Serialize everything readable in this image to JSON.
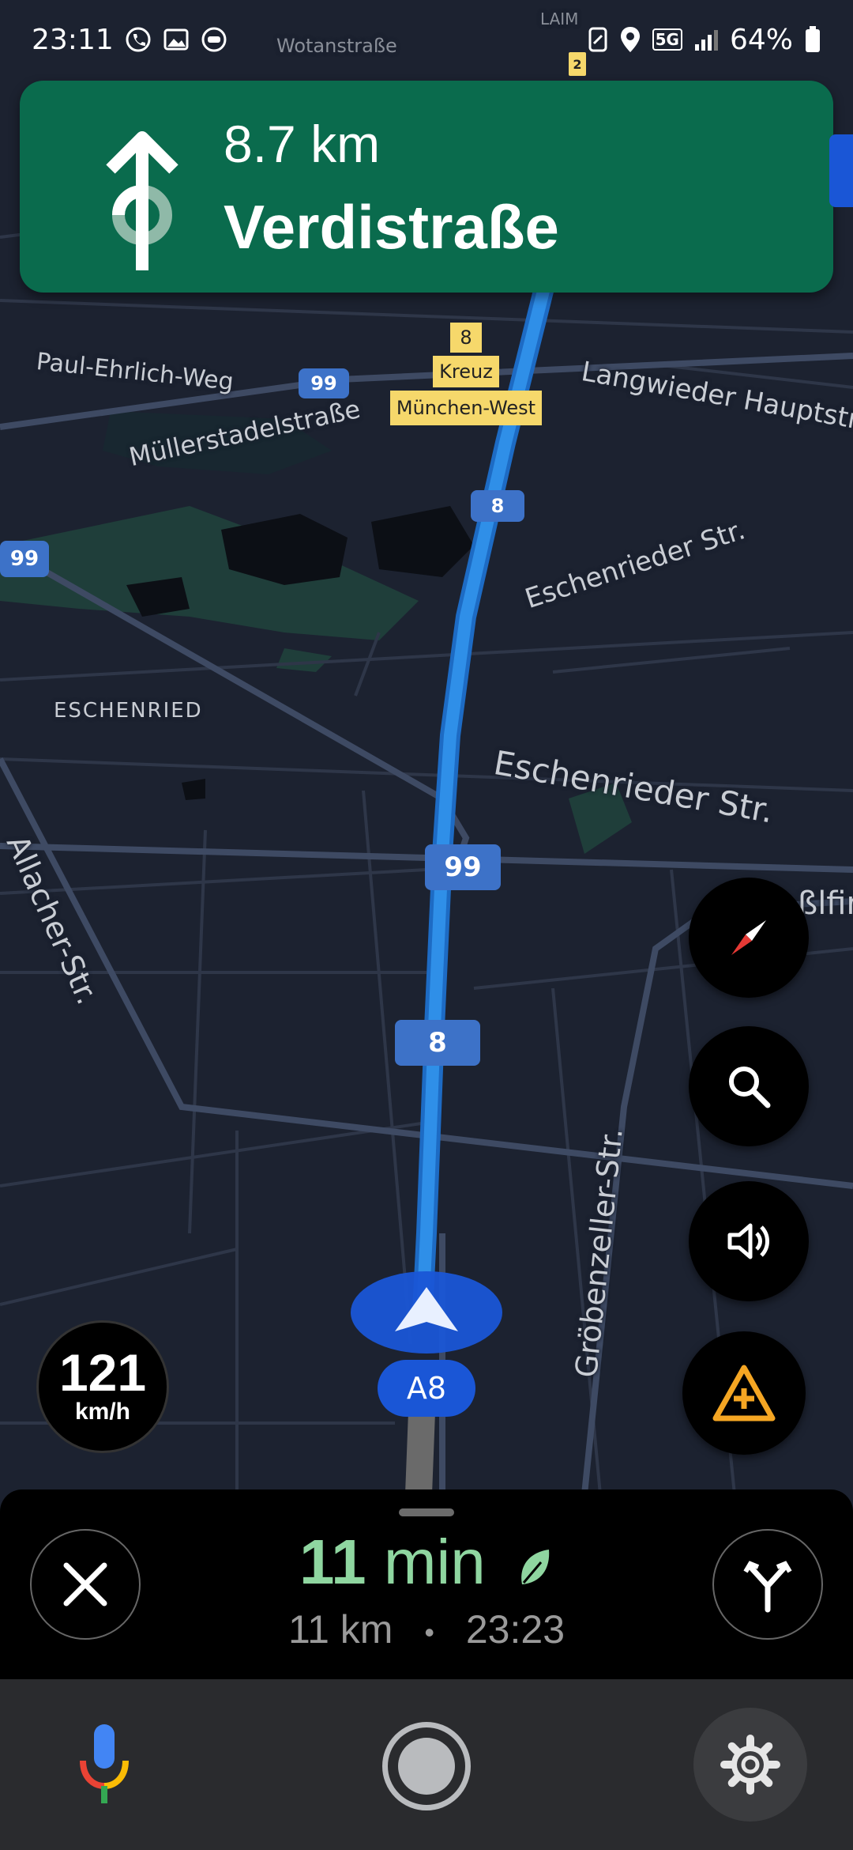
{
  "status_bar": {
    "time": "23:11",
    "battery": "64%",
    "network": "5G"
  },
  "guidance": {
    "distance": "8.7 km",
    "street": "Verdistraße",
    "maneuver_icon": "arrow-straight-roundabout-icon"
  },
  "map": {
    "labels": {
      "paul_ehrlich": "Paul-Ehrlich-Weg",
      "muellerstadel": "Müllerstadelstraße",
      "langwieder": "Langwieder Hauptstra",
      "eschenrieder1": "Eschenrieder Str.",
      "eschenrieder2": "Eschenrieder Str.",
      "eschenried": "ESCHENRIED",
      "allacher": "Allacher-Str.",
      "groebenzeller": "Gröbenzeller-Str.",
      "wotanstrasse": "Wotanstraße",
      "laim": "LAIM",
      "fragment_right": "ßlfir"
    },
    "signs": {
      "exit_number": "8",
      "line1": "Kreuz",
      "line2": "München-West"
    },
    "shields": {
      "r99a": "99",
      "r99b": "99",
      "r99c": "99",
      "r8a": "8",
      "r8b": "8",
      "r2": "2"
    },
    "current_road": "A8"
  },
  "speedometer": {
    "value": "121",
    "unit": "km/h"
  },
  "trip": {
    "minutes": "11",
    "minutes_unit": " min",
    "distance": "11 km",
    "separator": "•",
    "arrival": "23:23"
  },
  "colors": {
    "guidance_bg": "#0a6b4d",
    "route": "#2f8fe8",
    "eta": "#8fd6a0",
    "map_bg": "#1c2230"
  },
  "icons": [
    "compass-icon",
    "search-icon",
    "volume-icon",
    "report-incident-icon",
    "close-icon",
    "alternate-routes-icon",
    "mic-icon",
    "home-icon",
    "gear-icon"
  ]
}
